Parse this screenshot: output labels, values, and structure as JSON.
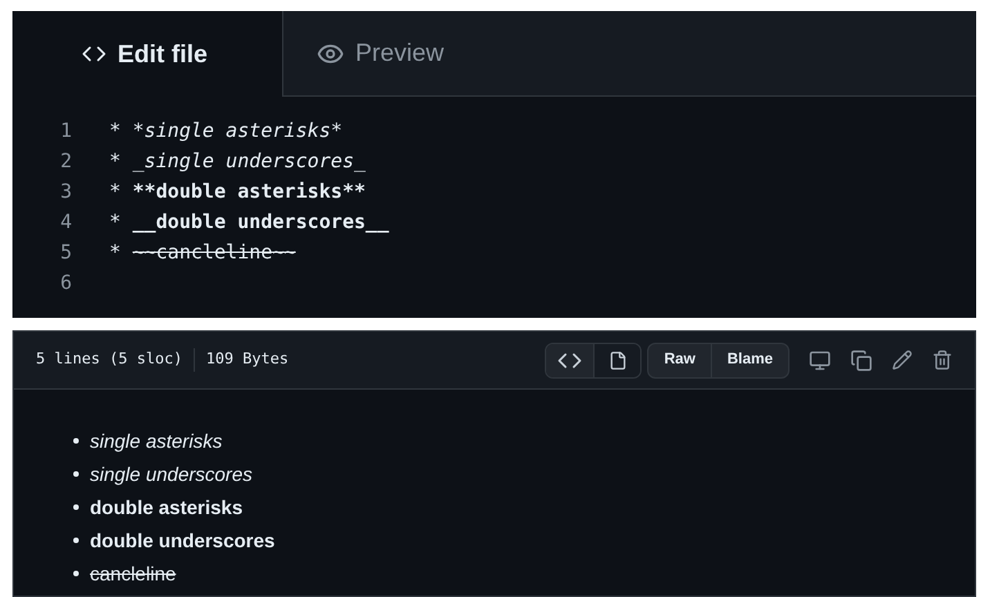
{
  "editor": {
    "tabs": [
      {
        "label": "Edit file",
        "kind": "code",
        "selected": true
      },
      {
        "label": "Preview",
        "kind": "eye",
        "selected": false
      }
    ],
    "lines": [
      {
        "number": "1",
        "marker": "*",
        "text": "*single asterisks*",
        "kind": "italic"
      },
      {
        "number": "2",
        "marker": "*",
        "text": "_single underscores_",
        "kind": "italic"
      },
      {
        "number": "3",
        "marker": "*",
        "text": "**double asterisks**",
        "kind": "bold"
      },
      {
        "number": "4",
        "marker": "*",
        "text": "__double underscores__",
        "kind": "bold"
      },
      {
        "number": "5",
        "marker": "*",
        "text": "~~cancleline~~",
        "kind": "strike"
      },
      {
        "number": "6"
      }
    ]
  },
  "file_view": {
    "info": [
      "5 lines (5 sloc)",
      "109 Bytes"
    ],
    "view_toggle": [
      {
        "kind": "code",
        "selected": true
      },
      {
        "kind": "file",
        "selected": false
      }
    ],
    "buttons": [
      "Raw",
      "Blame"
    ],
    "rendered": [
      {
        "text": "single asterisks",
        "kind": "italic"
      },
      {
        "text": "single underscores",
        "kind": "italic"
      },
      {
        "text": "double asterisks",
        "kind": "bold"
      },
      {
        "text": "double underscores",
        "kind": "bold"
      },
      {
        "text": "cancleline",
        "kind": "strike"
      }
    ]
  }
}
